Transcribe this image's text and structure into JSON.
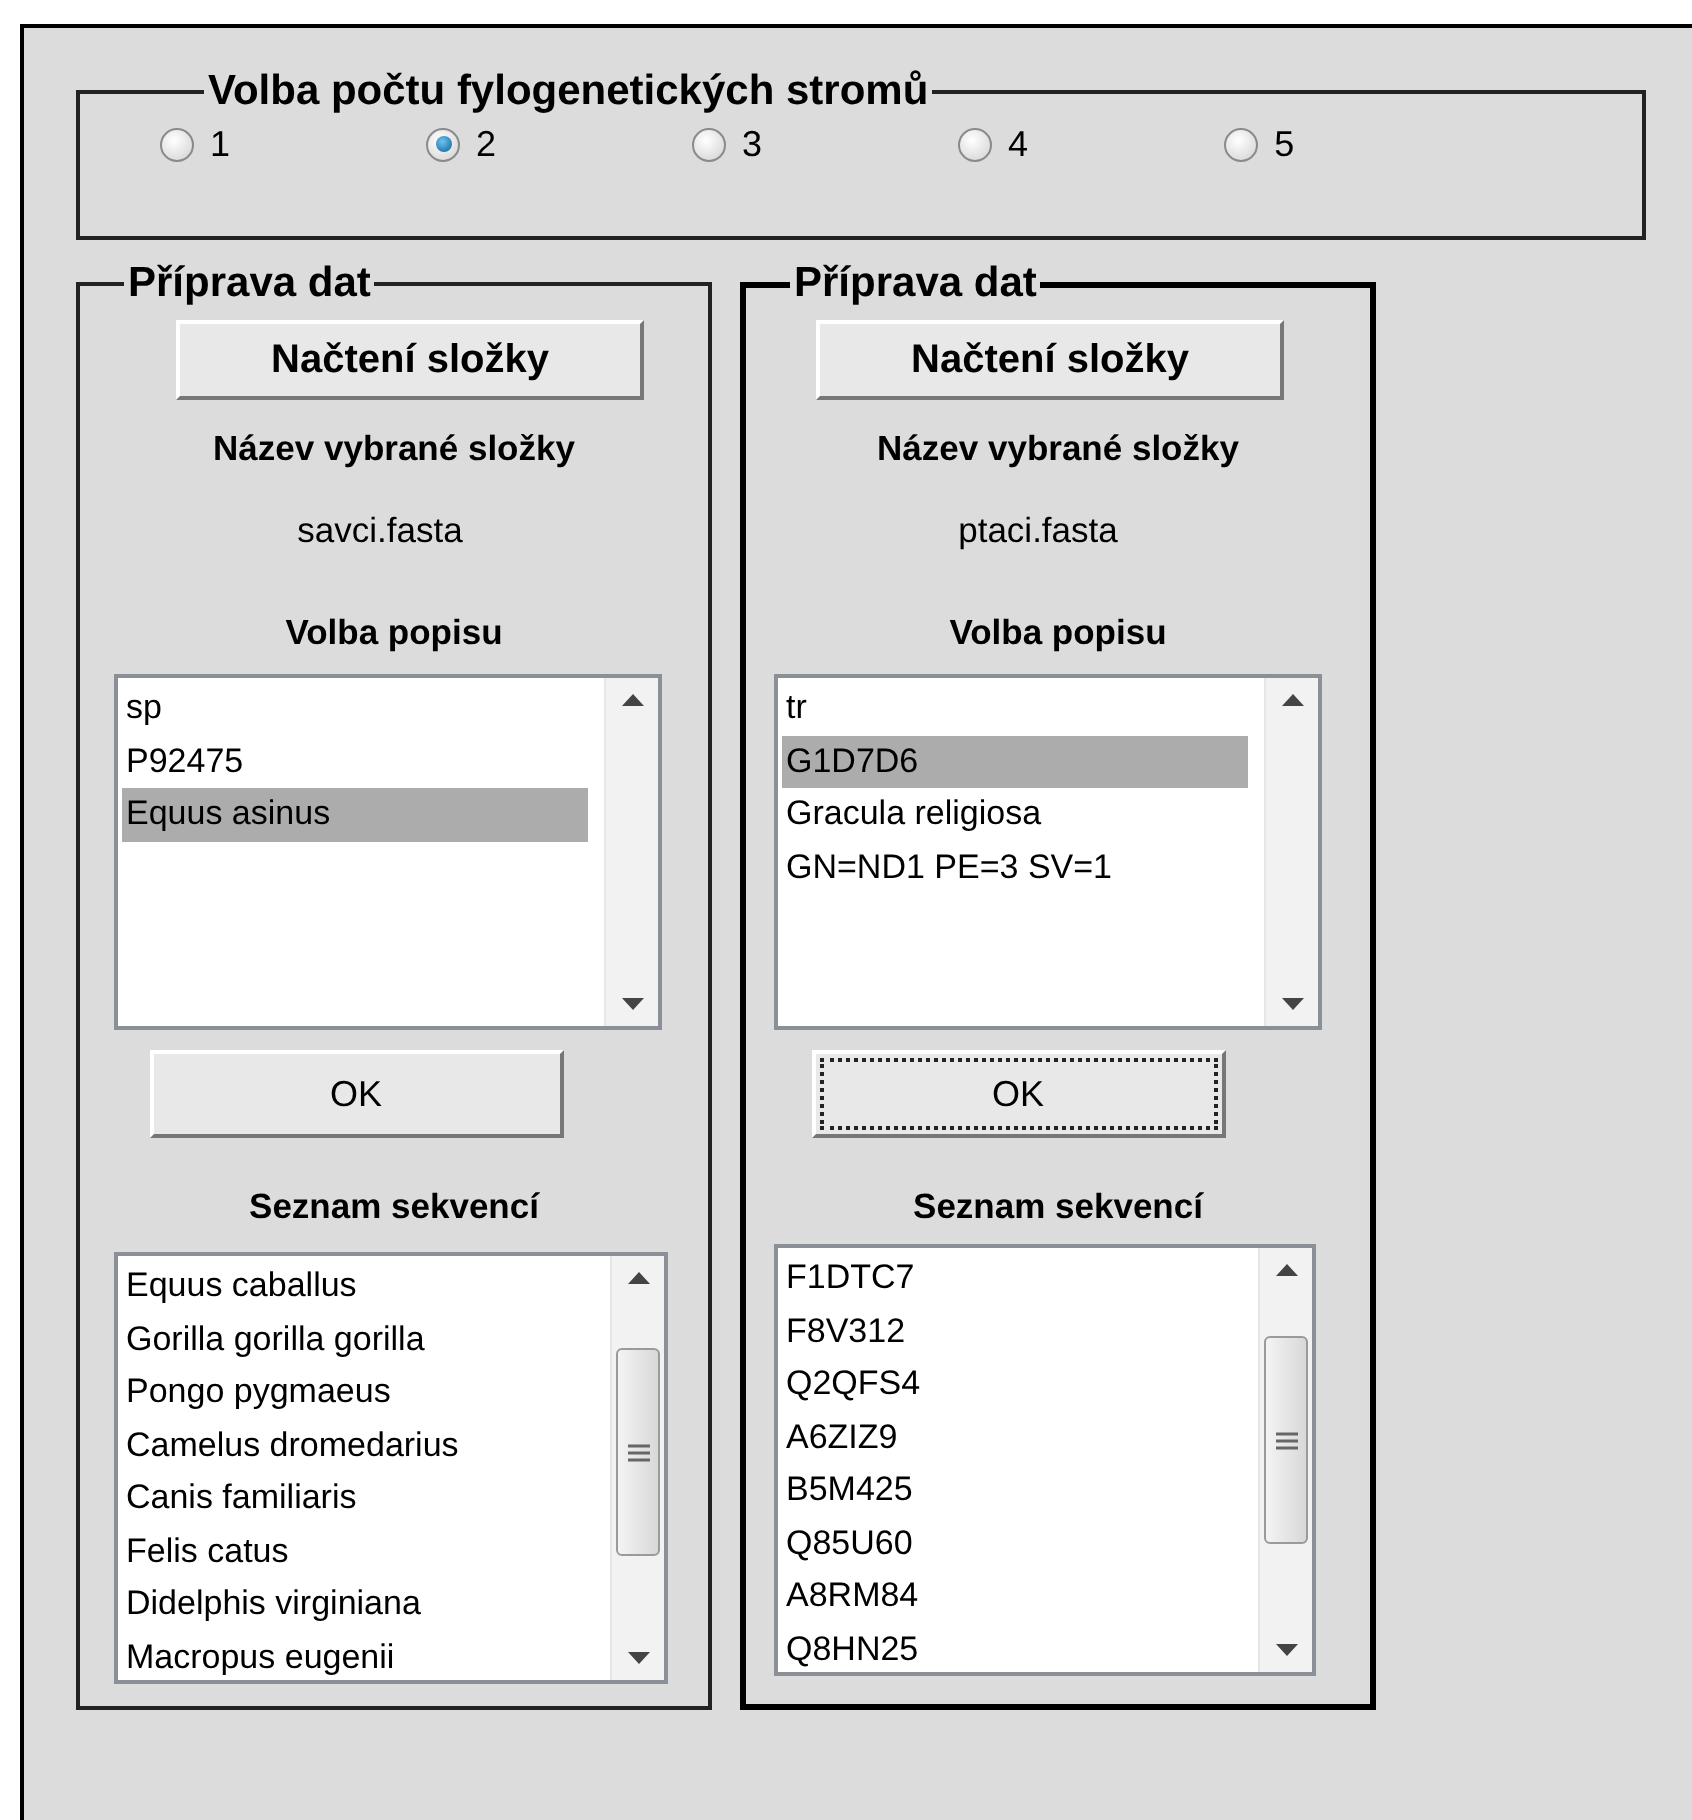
{
  "number_of_trees": {
    "title": "Volba počtu fylogenetických stromů",
    "options": [
      {
        "label": "1",
        "selected": false
      },
      {
        "label": "2",
        "selected": true
      },
      {
        "label": "3",
        "selected": false
      },
      {
        "label": "4",
        "selected": false
      },
      {
        "label": "5",
        "selected": false
      }
    ]
  },
  "panels": [
    {
      "title": "Příprava dat",
      "focused": false,
      "load_button": "Načtení složky",
      "folder_label": "Název vybrané složky",
      "folder_name": "savci.fasta",
      "description_label": "Volba popisu",
      "descriptions": [
        {
          "text": "sp",
          "selected": false
        },
        {
          "text": "P92475",
          "selected": false
        },
        {
          "text": "Equus asinus",
          "selected": true
        }
      ],
      "ok_button": {
        "label": "OK",
        "focused": false
      },
      "sequences_label": "Seznam sekvencí",
      "sequences": [
        {
          "text": "Equus caballus",
          "selected": false
        },
        {
          "text": "Gorilla gorilla gorilla",
          "selected": false
        },
        {
          "text": "Pongo pygmaeus",
          "selected": false
        },
        {
          "text": "Camelus dromedarius",
          "selected": false
        },
        {
          "text": "Canis familiaris",
          "selected": false
        },
        {
          "text": "Felis catus",
          "selected": false
        },
        {
          "text": "Didelphis virginiana",
          "selected": false
        },
        {
          "text": "Macropus eugenii",
          "selected": false
        }
      ]
    },
    {
      "title": "Příprava dat",
      "focused": true,
      "load_button": "Načtení složky",
      "folder_label": "Název vybrané složky",
      "folder_name": "ptaci.fasta",
      "description_label": "Volba popisu",
      "descriptions": [
        {
          "text": "tr",
          "selected": false
        },
        {
          "text": "G1D7D6",
          "selected": true
        },
        {
          "text": "Gracula religiosa",
          "selected": false
        },
        {
          "text": "GN=ND1 PE=3 SV=1",
          "selected": false
        }
      ],
      "ok_button": {
        "label": "OK",
        "focused": true
      },
      "sequences_label": "Seznam sekvencí",
      "sequences": [
        {
          "text": "F1DTC7",
          "selected": false
        },
        {
          "text": "F8V312",
          "selected": false
        },
        {
          "text": "Q2QFS4",
          "selected": false
        },
        {
          "text": "A6ZIZ9",
          "selected": false
        },
        {
          "text": "B5M425",
          "selected": false
        },
        {
          "text": "Q85U60",
          "selected": false
        },
        {
          "text": "A8RM84",
          "selected": false
        },
        {
          "text": "Q8HN25",
          "selected": false
        }
      ]
    }
  ]
}
